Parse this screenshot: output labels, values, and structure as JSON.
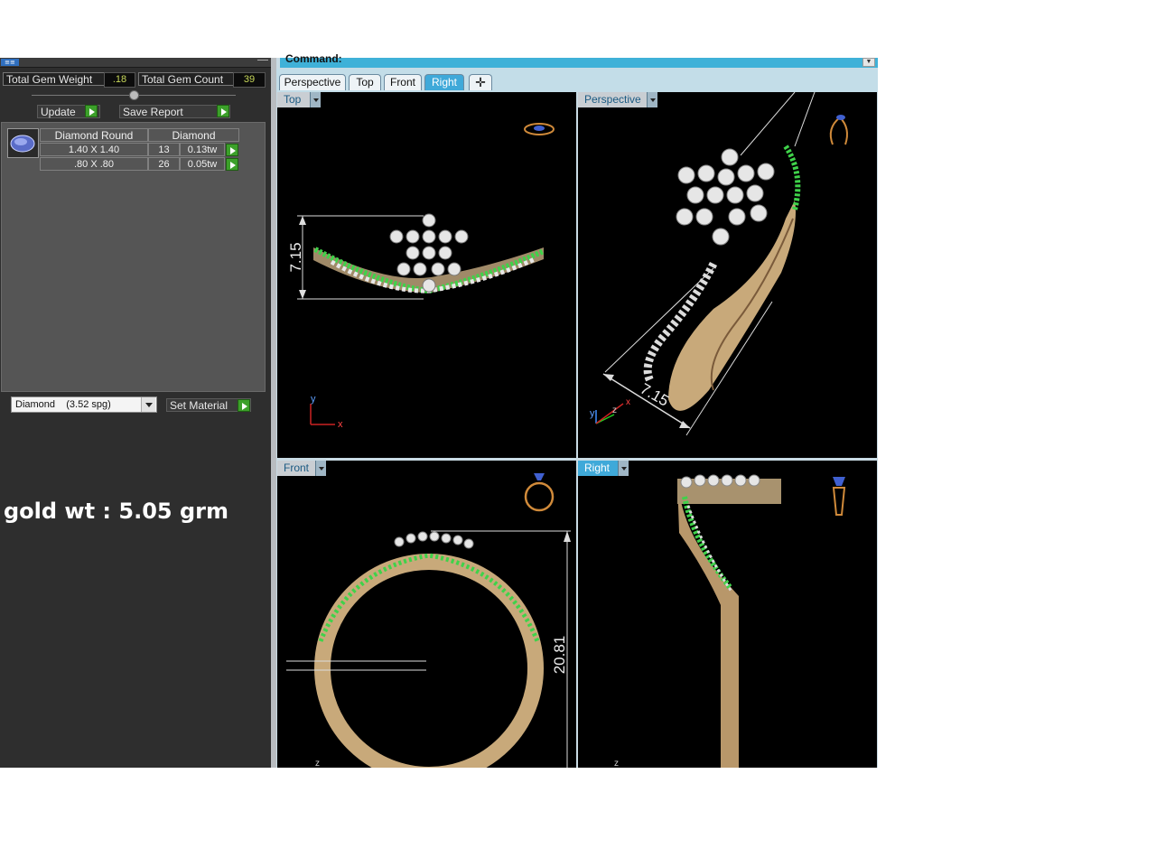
{
  "left_panel": {
    "total_gem_weight_label": "Total Gem Weight",
    "total_gem_weight_value": ".18",
    "total_gem_count_label": "Total Gem Count",
    "total_gem_count_value": "39",
    "update_button": "Update",
    "save_report_button": "Save Report",
    "table": {
      "headers": [
        "Diamond Round",
        "Diamond"
      ],
      "rows": [
        {
          "size": "1.40 X 1.40",
          "count": "13",
          "weight": "0.13tw"
        },
        {
          "size": ".80 X .80",
          "count": "26",
          "weight": "0.05tw"
        }
      ]
    },
    "material_select_value": "Diamond    (3.52 spg)",
    "set_material_button": "Set Material"
  },
  "overlay_text": "gold wt : 5.05 grm",
  "command_label": "Command:",
  "tabs": [
    {
      "label": "Perspective",
      "active": false
    },
    {
      "label": "Top",
      "active": false
    },
    {
      "label": "Front",
      "active": false
    },
    {
      "label": "Right",
      "active": true
    }
  ],
  "add_tab_icon": "plus-icon",
  "viewports": {
    "top": {
      "label": "Top",
      "dimension": "7.15",
      "axes": [
        "y",
        "x"
      ]
    },
    "perspective": {
      "label": "Perspective",
      "dimension": "7.15",
      "axes": [
        "y",
        "z",
        "x"
      ]
    },
    "front": {
      "label": "Front",
      "dimension": "20.81",
      "axes": [
        "z"
      ]
    },
    "right": {
      "label": "Right",
      "axes": [
        "z"
      ]
    }
  },
  "colors": {
    "panel_bg": "#2e2e2e",
    "accent": "#3fa9d9",
    "gold": "#c8a97a",
    "gem_green": "#3fd24a",
    "viewport_bg": "#000000"
  }
}
